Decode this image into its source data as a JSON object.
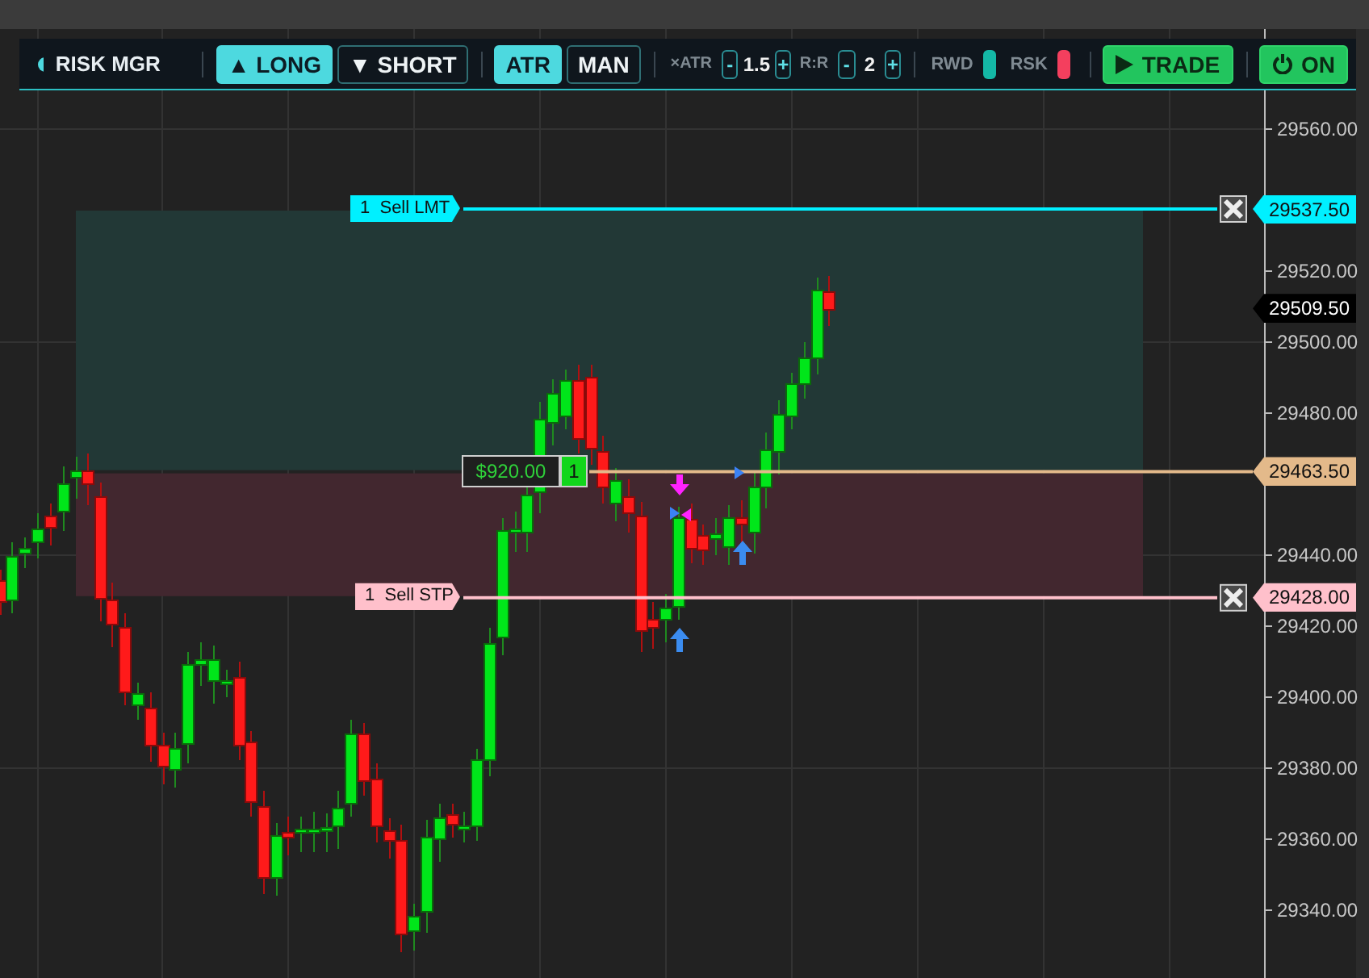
{
  "toolbar": {
    "title": "RISK MGR",
    "direction_buttons": [
      {
        "icon": "▲",
        "label": "LONG",
        "selected": true
      },
      {
        "icon": "▼",
        "label": "SHORT",
        "selected": false
      }
    ],
    "mode_buttons": [
      {
        "label": "ATR",
        "selected": true
      },
      {
        "label": "MAN",
        "selected": false
      }
    ],
    "steppers": [
      {
        "label": "×ATR",
        "minus": "-",
        "value": "1.5",
        "plus": "+"
      },
      {
        "label": "R:R",
        "minus": "-",
        "value": "2",
        "plus": "+"
      }
    ],
    "swatches": [
      {
        "label": "RWD",
        "color": "#14b8a6"
      },
      {
        "label": "RSK",
        "color": "#f43f5e"
      }
    ],
    "trade_button": {
      "label": "TRADE"
    },
    "power_button": {
      "label": "ON",
      "on": true
    }
  },
  "chart": {
    "price_axis": {
      "ticks": [
        "29560.00",
        "29520.00",
        "29500.00",
        "29480.00",
        "29440.00",
        "29420.00",
        "29400.00",
        "29380.00",
        "29360.00",
        "29340.00"
      ]
    },
    "current_price": "29509.50",
    "orders": [
      {
        "kind": "limit",
        "label": "1  Sell LMT",
        "price": "29537.50",
        "color": "#00f0ff"
      },
      {
        "kind": "stop",
        "label": "1  Sell STP",
        "price": "29428.00",
        "color": "#ffc0cb"
      }
    ],
    "position": {
      "pnl": "$920.00",
      "qty": "1",
      "price": "29463.50",
      "color": "#e3b98a"
    }
  }
}
